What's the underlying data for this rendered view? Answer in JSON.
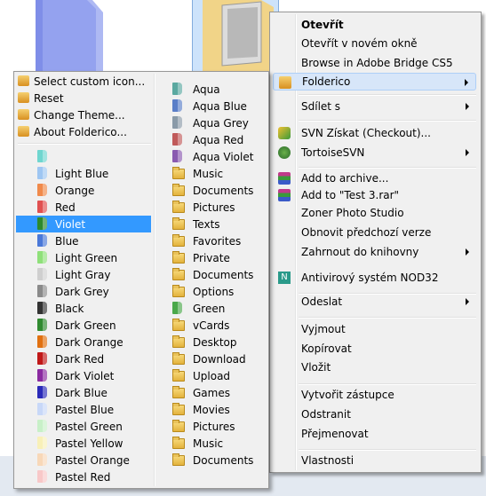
{
  "context_menu": {
    "items": [
      {
        "label": "Otevřít",
        "bold": true,
        "icon": "none",
        "submenu": false
      },
      {
        "label": "Otevřít v novém okně",
        "icon": "none",
        "submenu": false
      },
      {
        "label": "Browse in Adobe Bridge CS5",
        "icon": "none",
        "submenu": false
      },
      {
        "label": "Folderico",
        "icon": "folderico-icon",
        "submenu": true,
        "highlighted": true
      },
      {
        "label": "Sdílet s",
        "icon": "none",
        "submenu": true
      },
      {
        "label": "SVN Získat (Checkout)...",
        "icon": "svn-checkout-icon",
        "submenu": false
      },
      {
        "label": "TortoiseSVN",
        "icon": "tortoisesvn-icon",
        "submenu": true
      },
      {
        "label": "Add to archive...",
        "icon": "winrar-icon",
        "submenu": false
      },
      {
        "label": "Add to \"Test 3.rar\"",
        "icon": "winrar-icon",
        "submenu": false
      },
      {
        "label": "Zoner Photo Studio",
        "icon": "none",
        "submenu": false
      },
      {
        "label": "Obnovit předchozí verze",
        "icon": "none",
        "submenu": false
      },
      {
        "label": "Zahrnout do knihovny",
        "icon": "none",
        "submenu": true
      },
      {
        "label": "Antivirový systém NOD32",
        "icon": "nod32-icon",
        "submenu": false
      },
      {
        "label": "Odeslat",
        "icon": "none",
        "submenu": true
      },
      {
        "label": "Vyjmout",
        "icon": "none",
        "submenu": false
      },
      {
        "label": "Kopírovat",
        "icon": "none",
        "submenu": false
      },
      {
        "label": "Vložit",
        "icon": "none",
        "submenu": false
      },
      {
        "label": "Vytvořit zástupce",
        "icon": "none",
        "submenu": false
      },
      {
        "label": "Odstranit",
        "icon": "none",
        "submenu": false
      },
      {
        "label": "Přejmenovat",
        "icon": "none",
        "submenu": false
      },
      {
        "label": "Vlastnosti",
        "icon": "none",
        "submenu": false
      }
    ]
  },
  "folderico_menu": {
    "actions": [
      {
        "label": "Select custom icon...",
        "icon": "folderico-icon"
      },
      {
        "label": "Reset",
        "icon": "folderico-icon"
      },
      {
        "label": "Change Theme...",
        "icon": "folderico-icon"
      },
      {
        "label": "About Folderico...",
        "icon": "folderico-icon"
      }
    ],
    "colors": [
      {
        "label": "",
        "color": "#6fd6cf"
      },
      {
        "label": "Light Blue",
        "color": "#9ec6f2"
      },
      {
        "label": "Orange",
        "color": "#f08a4b"
      },
      {
        "label": "Red",
        "color": "#e05050"
      },
      {
        "label": "Violet",
        "color": "#2c8a2c",
        "selected": true
      },
      {
        "label": "Blue",
        "color": "#4a78d8"
      },
      {
        "label": "Light Green",
        "color": "#8fe07a"
      },
      {
        "label": "Light Gray",
        "color": "#cfcfcf"
      },
      {
        "label": "Dark Grey",
        "color": "#8a8a8a"
      },
      {
        "label": "Black",
        "color": "#333333"
      },
      {
        "label": "Dark Green",
        "color": "#2f8a2f"
      },
      {
        "label": "Dark Orange",
        "color": "#e07010"
      },
      {
        "label": "Dark Red",
        "color": "#c01818"
      },
      {
        "label": "Dark Violet",
        "color": "#8a2aa0"
      },
      {
        "label": "Dark Blue",
        "color": "#2a2ab8"
      },
      {
        "label": "Pastel Blue",
        "color": "#c8d8f8"
      },
      {
        "label": "Pastel Green",
        "color": "#c8f0c8"
      },
      {
        "label": "Pastel Yellow",
        "color": "#f8f0b8"
      },
      {
        "label": "Pastel Orange",
        "color": "#f8d8b8"
      },
      {
        "label": "Pastel Red",
        "color": "#f8c8c8"
      }
    ],
    "themes": [
      {
        "label": "Aqua",
        "icon": "aqua-folder-icon",
        "color": "#5aa8a0"
      },
      {
        "label": "Aqua Blue",
        "icon": "aqua-blue-folder-icon",
        "color": "#5a7ec8"
      },
      {
        "label": "Aqua Grey",
        "icon": "aqua-grey-folder-icon",
        "color": "#8a9aa8"
      },
      {
        "label": "Aqua Red",
        "icon": "aqua-red-folder-icon",
        "color": "#c05a5a"
      },
      {
        "label": "Aqua Violet",
        "icon": "aqua-violet-folder-icon",
        "color": "#8a5ab0"
      },
      {
        "label": "Music",
        "icon": "music-folder-icon"
      },
      {
        "label": "Documents",
        "icon": "documents-folder-icon"
      },
      {
        "label": "Pictures",
        "icon": "pictures-folder-icon"
      },
      {
        "label": "Texts",
        "icon": "texts-folder-icon"
      },
      {
        "label": "Favorites",
        "icon": "favorites-folder-icon"
      },
      {
        "label": "Private",
        "icon": "private-folder-icon"
      },
      {
        "label": "Documents",
        "icon": "documents-folder-icon"
      },
      {
        "label": "Options",
        "icon": "options-folder-icon"
      },
      {
        "label": "Green",
        "icon": "green-folder-icon",
        "color": "#4aa84a"
      },
      {
        "label": "vCards",
        "icon": "vcards-folder-icon"
      },
      {
        "label": "Desktop",
        "icon": "desktop-folder-icon"
      },
      {
        "label": "Download",
        "icon": "download-folder-icon"
      },
      {
        "label": "Upload",
        "icon": "upload-folder-icon"
      },
      {
        "label": "Games",
        "icon": "games-folder-icon"
      },
      {
        "label": "Movies",
        "icon": "movies-folder-icon"
      },
      {
        "label": "Pictures",
        "icon": "pictures-folder-icon"
      },
      {
        "label": "Music",
        "icon": "music-folder-icon"
      },
      {
        "label": "Documents",
        "icon": "documents-folder-icon"
      }
    ]
  }
}
